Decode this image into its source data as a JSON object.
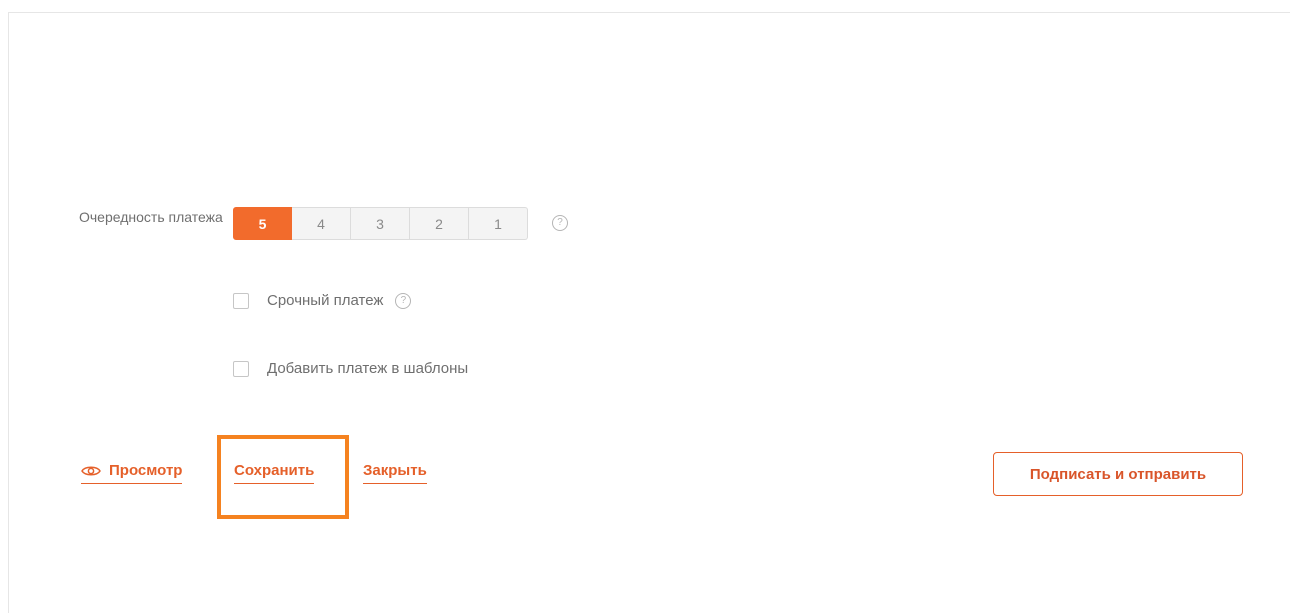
{
  "priority": {
    "label": "Очередность платежа",
    "options": [
      "5",
      "4",
      "3",
      "2",
      "1"
    ],
    "selected": "5",
    "help_icon": "question-circle-icon",
    "help_glyph": "?"
  },
  "checkboxes": {
    "urgent": {
      "label": "Срочный платеж",
      "checked": false,
      "help_glyph": "?"
    },
    "add_to_templates": {
      "label": "Добавить платеж в шаблоны",
      "checked": false
    }
  },
  "actions": {
    "preview_label": "Просмотр",
    "preview_icon": "eye-icon",
    "save_label": "Сохранить",
    "close_label": "Закрыть",
    "sign_send_label": "Подписать и отправить"
  },
  "colors": {
    "accent": "#f26b2c",
    "link": "#e5602a",
    "highlight": "#f58220"
  }
}
